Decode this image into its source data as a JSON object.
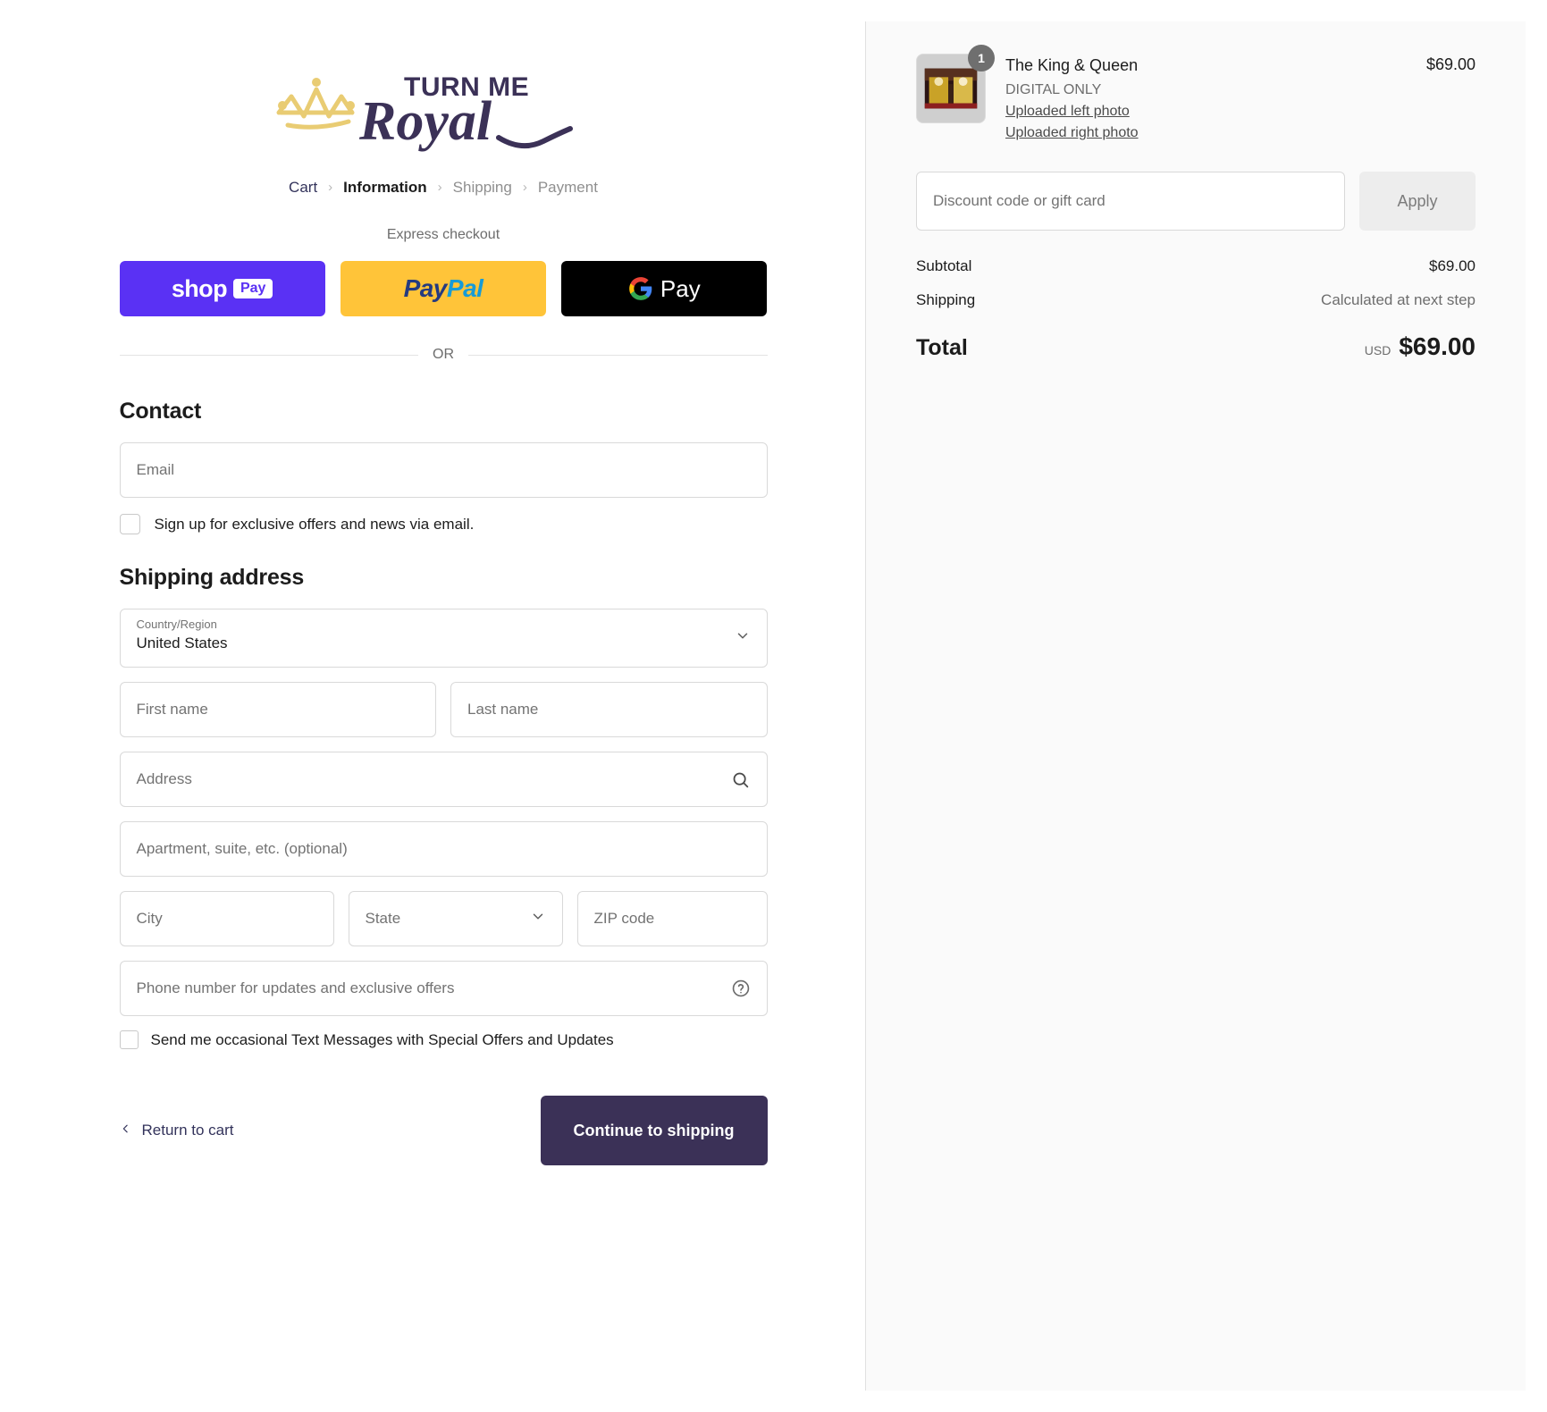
{
  "brand": {
    "logo_top_text": "TURN ME",
    "logo_script_text": "Royal",
    "crown_color": "#E9CC73",
    "wordmark_color": "#3B3157"
  },
  "breadcrumb": {
    "items": [
      {
        "label": "Cart",
        "state": "link"
      },
      {
        "label": "Information",
        "state": "current"
      },
      {
        "label": "Shipping",
        "state": "upcoming"
      },
      {
        "label": "Payment",
        "state": "upcoming"
      }
    ],
    "separator": "›"
  },
  "express": {
    "label": "Express checkout",
    "buttons": [
      {
        "name": "shop-pay",
        "word": "shop",
        "pill": "Pay",
        "bg": "#5A31F4"
      },
      {
        "name": "paypal",
        "word1": "Pay",
        "word2": "Pal",
        "bg": "#FFC439"
      },
      {
        "name": "google-pay",
        "text": "Pay",
        "bg": "#000000"
      }
    ],
    "divider_text": "OR"
  },
  "contact": {
    "heading": "Contact",
    "email_placeholder": "Email",
    "newsletter_checkbox_label": "Sign up for exclusive offers and news via email."
  },
  "shipping_address": {
    "heading": "Shipping address",
    "country_label": "Country/Region",
    "country_value": "United States",
    "first_name_placeholder": "First name",
    "last_name_placeholder": "Last name",
    "address_placeholder": "Address",
    "apartment_placeholder": "Apartment, suite, etc. (optional)",
    "city_placeholder": "City",
    "state_placeholder": "State",
    "zip_placeholder": "ZIP code",
    "phone_placeholder": "Phone number for updates and exclusive offers",
    "sms_checkbox_label": "Send me occasional Text Messages with Special Offers and Updates"
  },
  "footer": {
    "return_label": "Return to cart",
    "continue_label": "Continue to shipping",
    "continue_bg": "#3B3157"
  },
  "summary": {
    "item": {
      "quantity": "1",
      "title": "The King & Queen",
      "variant": "DIGITAL ONLY",
      "link_left": "Uploaded left photo",
      "link_right": "Uploaded right photo",
      "price": "$69.00"
    },
    "discount_placeholder": "Discount code or gift card",
    "apply_label": "Apply",
    "subtotal_label": "Subtotal",
    "subtotal_value": "$69.00",
    "shipping_label": "Shipping",
    "shipping_value": "Calculated at next step",
    "total_label": "Total",
    "currency": "USD",
    "total_value": "$69.00"
  }
}
